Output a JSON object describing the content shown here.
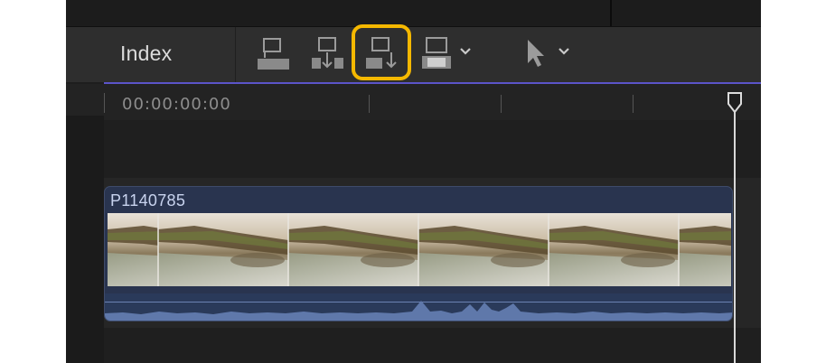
{
  "toolbar": {
    "index_label": "Index",
    "buttons": [
      {
        "name": "connect-clip-button",
        "icon": "connect-icon"
      },
      {
        "name": "insert-clip-button",
        "icon": "insert-icon"
      },
      {
        "name": "append-clip-button",
        "icon": "append-icon",
        "highlighted": true
      },
      {
        "name": "overwrite-clip-button",
        "icon": "overwrite-icon",
        "has_menu": true
      },
      {
        "name": "select-tool-button",
        "icon": "arrow-pointer-icon",
        "has_menu": true
      }
    ]
  },
  "timeline": {
    "timecode": "00:00:00:00"
  },
  "clip": {
    "name": "P1140785"
  },
  "colors": {
    "highlight": "#f5b800",
    "accent_line": "#5b54c9",
    "clip_bg": "#29344f",
    "waveform": "#5f78aa"
  }
}
